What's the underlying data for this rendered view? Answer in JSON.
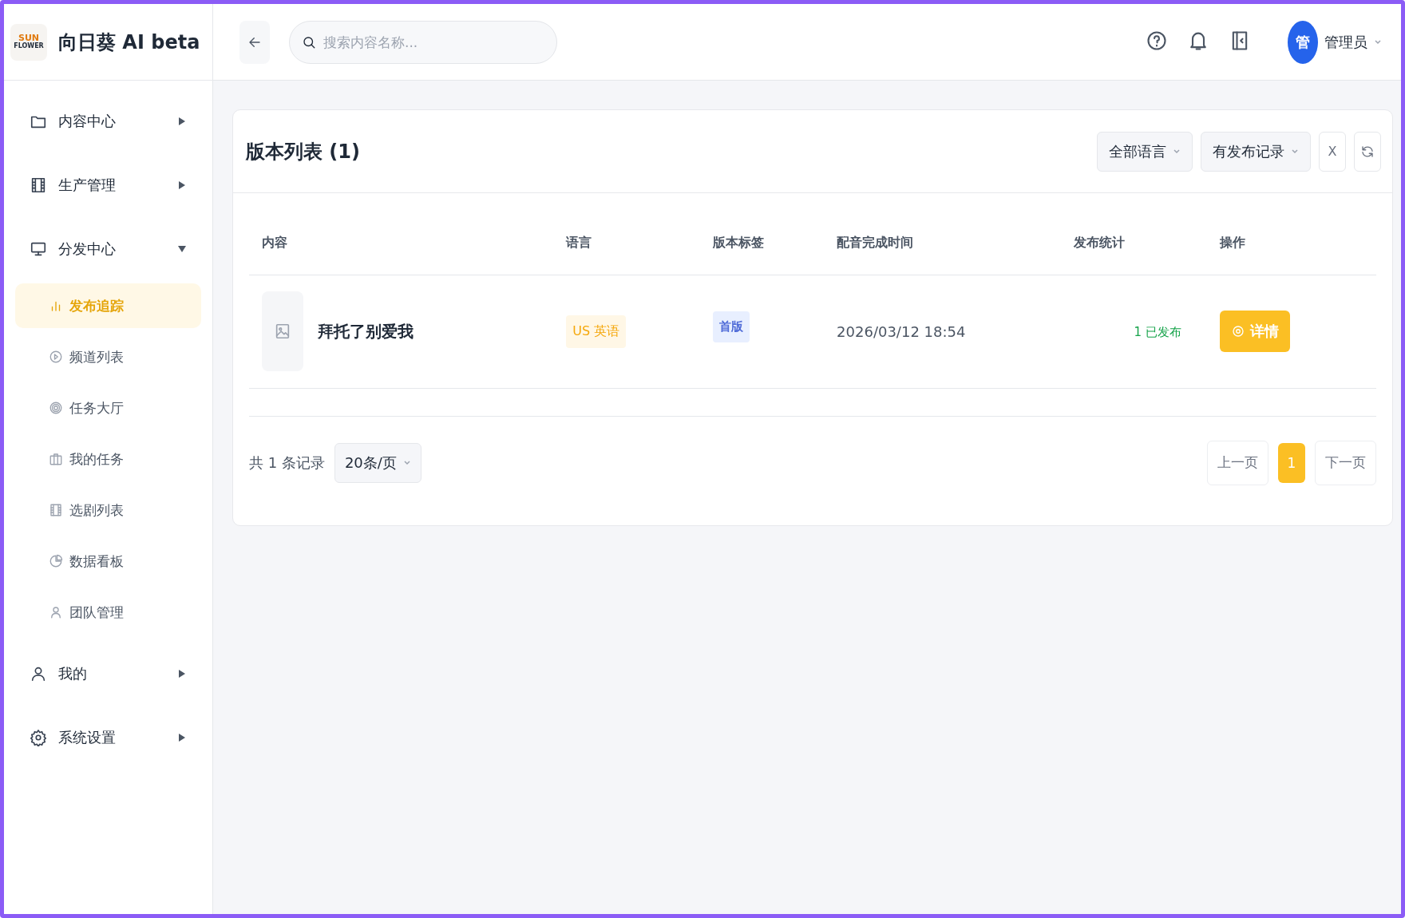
{
  "brand": {
    "logo_top": "SUN",
    "logo_bottom": "FLOWER",
    "name": "向日葵 AI beta"
  },
  "topbar": {
    "search": {
      "placeholder": "搜索内容名称..."
    },
    "user": {
      "avatar": "管",
      "name": "管理员"
    }
  },
  "sidebar": {
    "items": [
      {
        "label": "内容中心",
        "expanded": false
      },
      {
        "label": "生产管理",
        "expanded": false
      },
      {
        "label": "分发中心",
        "expanded": true,
        "children": [
          {
            "label": "发布追踪",
            "selected": true
          },
          {
            "label": "频道列表",
            "selected": false
          },
          {
            "label": "任务大厅",
            "selected": false
          },
          {
            "label": "我的任务",
            "selected": false
          },
          {
            "label": "选剧列表",
            "selected": false
          },
          {
            "label": "数据看板",
            "selected": false
          },
          {
            "label": "团队管理",
            "selected": false
          }
        ]
      },
      {
        "label": "我的",
        "expanded": false
      },
      {
        "label": "系统设置",
        "expanded": false
      }
    ]
  },
  "card": {
    "title": "版本列表 (1)",
    "filters": [
      {
        "label": "全部语言"
      },
      {
        "label": "有发布记录"
      }
    ],
    "clear": "X",
    "table": {
      "columns": [
        "内容",
        "语言",
        "版本标签",
        "配音完成时间",
        "发布统计",
        "操作"
      ],
      "rows": [
        {
          "title": "拜托了别爱我",
          "language": "US 英语",
          "tag": "首版",
          "time": "2026/03/12 18:54",
          "stats": "1 已发布",
          "action": "详情"
        }
      ]
    },
    "pagination": {
      "total": "共 1 条记录",
      "page_size": "20条/页",
      "prev": "上一页",
      "pages": [
        {
          "label": "1",
          "selected": true
        }
      ],
      "next": "下一页"
    }
  }
}
